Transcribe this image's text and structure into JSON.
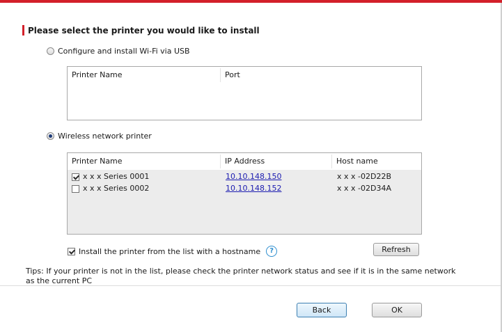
{
  "title": "Please select the printer you would like to install",
  "options": {
    "usb": {
      "label": "Configure and install Wi-Fi via USB",
      "selected": false
    },
    "wireless": {
      "label": "Wireless network printer",
      "selected": true
    }
  },
  "usb_table": {
    "columns": [
      "Printer Name",
      "Port"
    ],
    "rows": []
  },
  "wireless_table": {
    "columns": [
      "Printer Name",
      "IP Address",
      "Host name"
    ],
    "rows": [
      {
        "checked": true,
        "name": "x x x Series 0001",
        "ip": "10.10.148.150",
        "host": "x x x -02D22B"
      },
      {
        "checked": false,
        "name": "x x x Series 0002",
        "ip": "10.10.148.152",
        "host": "x x x -02D34A"
      }
    ]
  },
  "hostname_option": {
    "label": "Install the printer from the list with a hostname",
    "checked": true
  },
  "help_icon": "?",
  "refresh_label": "Refresh",
  "tips": "Tips: If your printer is not in the list, please check the printer network status and see if it is in the same network as the current PC",
  "buttons": {
    "back": "Back",
    "ok": "OK"
  },
  "colors": {
    "accent": "#d3202a",
    "link": "#1b1bb0"
  }
}
